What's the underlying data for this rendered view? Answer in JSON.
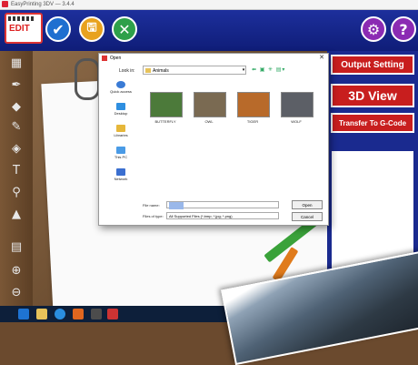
{
  "window": {
    "title": "EasyPrinting 3DV — 3.4.4"
  },
  "toolbar": {
    "logo_text": "EDIT",
    "confirm_glyph": "✔",
    "save_glyph": "🖫",
    "cancel_glyph": "✕",
    "settings_glyph": "⚙",
    "help_glyph": "?"
  },
  "left_tools": [
    {
      "icon": "select-icon",
      "glyph": "▦"
    },
    {
      "icon": "pen-icon",
      "glyph": "✒"
    },
    {
      "icon": "eraser-icon",
      "glyph": "◆"
    },
    {
      "icon": "brush-icon",
      "glyph": "✎"
    },
    {
      "icon": "fill-icon",
      "glyph": "◈"
    },
    {
      "icon": "text-icon",
      "glyph": "T"
    },
    {
      "icon": "magnify-icon",
      "glyph": "⚲"
    },
    {
      "icon": "stamp-icon",
      "glyph": "▲"
    },
    {
      "icon": "layers-icon",
      "glyph": "▤"
    },
    {
      "icon": "zoom-in-icon",
      "glyph": "⊕"
    },
    {
      "icon": "zoom-out-icon",
      "glyph": "⊖"
    }
  ],
  "right_panel": {
    "output_setting": "Output Setting",
    "view_3d": "3D View",
    "transfer_gcode": "Transfer To G-Code"
  },
  "dialog": {
    "title": "Open",
    "close_glyph": "✕",
    "look_in_label": "Look in:",
    "look_in_value": "Animals",
    "places": [
      "Quick access",
      "Desktop",
      "Libraries",
      "This PC",
      "Network"
    ],
    "files": [
      {
        "name": "BUTTERFLY",
        "color": "#4c7a3a"
      },
      {
        "name": "OWL",
        "color": "#7a6a52"
      },
      {
        "name": "TIGER",
        "color": "#b86a2a"
      },
      {
        "name": "WOLF",
        "color": "#5c5f66"
      }
    ],
    "file_name_label": "File name:",
    "file_type_label": "Files of type:",
    "file_type_value": "All Supported Files (*.bmp; *.jpg; *.png)",
    "open_button": "Open",
    "cancel_button": "Cancel"
  }
}
